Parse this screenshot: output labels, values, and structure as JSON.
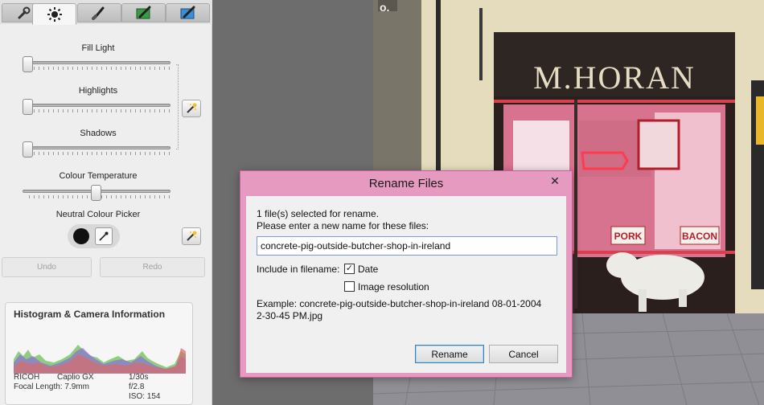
{
  "left_panel": {
    "tabs": [
      {
        "name": "tools-tab",
        "icon": "wrench-icon"
      },
      {
        "name": "tuning-tab",
        "icon": "sun-icon"
      },
      {
        "name": "effects-tab-1",
        "icon": "brush-icon"
      },
      {
        "name": "effects-tab-2",
        "icon": "green-brush-icon"
      },
      {
        "name": "effects-tab-3",
        "icon": "blue-brush-icon"
      }
    ],
    "sliders": {
      "fill_light": {
        "label": "Fill Light",
        "value": 0
      },
      "highlights": {
        "label": "Highlights",
        "value": 0
      },
      "shadows": {
        "label": "Shadows",
        "value": 0
      },
      "colour_temperature": {
        "label": "Colour Temperature",
        "value": 0.5
      }
    },
    "neutral_picker_label": "Neutral Colour Picker",
    "undo_label": "Undo",
    "redo_label": "Redo",
    "histogram": {
      "title": "Histogram & Camera Information",
      "camera_make": "RICOH",
      "camera_model": "Caplio GX",
      "focal_length": "Focal Length: 7.9mm",
      "shutter": "1/30s",
      "aperture": "f/2.8",
      "iso": "ISO: 154"
    }
  },
  "photo": {
    "shop_sign": "M.HORAN",
    "pork_label": "PORK",
    "bacon_label": "BACON",
    "top_fragment": "o."
  },
  "dialog": {
    "title": "Rename Files",
    "close_label": "✕",
    "selected_text": "1 file(s) selected for rename.",
    "prompt_text": "Please enter a new name for these files:",
    "name_value": "concrete-pig-outside-butcher-shop-in-ireland",
    "include_label": "Include in filename:",
    "date_label": "Date",
    "date_checked": true,
    "resolution_label": "Image resolution",
    "resolution_checked": false,
    "example_line1": "Example:  concrete-pig-outside-butcher-shop-in-ireland 08-01-2004",
    "example_line2": "2-30-45 PM.jpg",
    "rename_button": "Rename",
    "cancel_button": "Cancel"
  },
  "colors": {
    "dialog_frame": "#e79ac0",
    "default_button_border": "#3c7fb1"
  }
}
